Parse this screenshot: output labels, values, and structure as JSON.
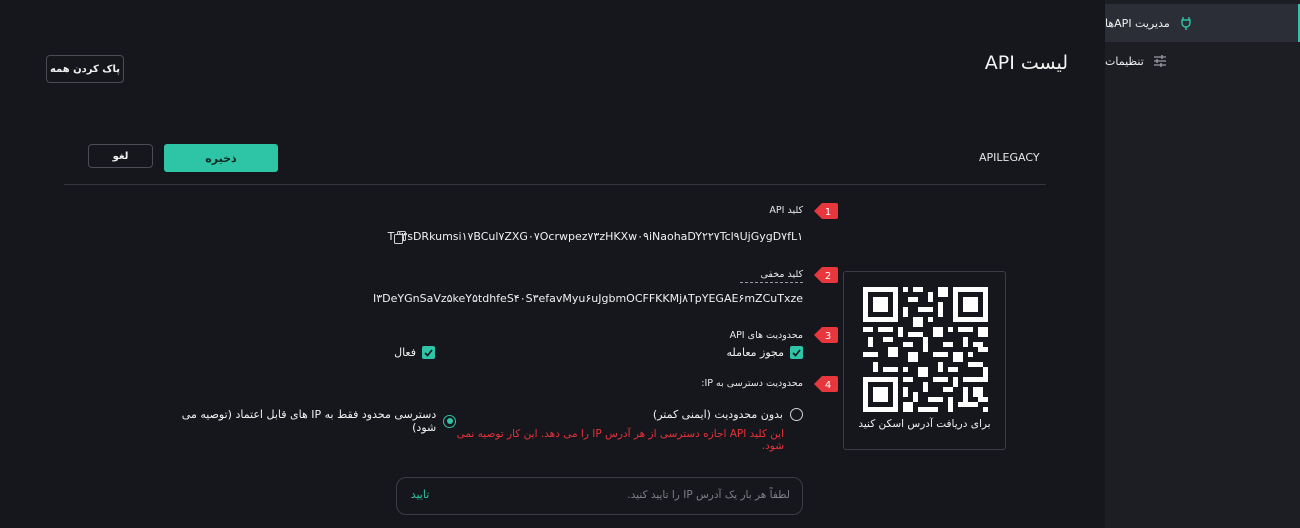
{
  "sidebar": {
    "items": [
      {
        "label": "مدیریت APIها",
        "icon": "plug-icon"
      },
      {
        "label": "تنظیمات",
        "icon": "sliders-icon"
      }
    ]
  },
  "header": {
    "title": "لیست API",
    "clear_all_label": "پاک کردن همه"
  },
  "api_entry": {
    "name": "APILEGACY",
    "save_label": "ذخیره",
    "cancel_label": "لغو"
  },
  "fields": {
    "api_key_label": "کلید API",
    "api_key_value": "Td۳sDRkumsi۱۷BCul۷ZXG۰۷Ocrwpez۷۳zHKXw۰۹iNaohaDY۲۲۷Tcl۹UjGygD۷fL۱",
    "secret_key_label": "کلید مخفی",
    "secret_key_value": "I۳DeYGnSaVz۵keY۵tdhfeS۴۰S۳efavMyu۶uJgbmOCFFKKMj۸TpYEGAE۶mZCuTxze",
    "restrictions_label": "محدودیت های API",
    "trade_permission_label": "مجوز معامله",
    "active_label": "فعال",
    "ip_restriction_label": "محدودیت دسترسی به IP:",
    "no_restriction_label": "بدون محدودیت (ایمنی کمتر)",
    "restricted_label": "دسترسی محدود فقط به IP های قابل اعتماد (توصیه می شود)",
    "warning_text": "این کلید API اجازه دسترسی از هر آدرس IP را می دهد. این کار توصیه نمی شود.",
    "ip_placeholder": "لطفاً هر بار یک آدرس IP را تایید کنید.",
    "confirm_label": "تایید"
  },
  "badges": [
    "1",
    "2",
    "3",
    "4"
  ],
  "qr": {
    "caption": "برای دریافت آدرس اسکن کنید"
  },
  "colors": {
    "accent": "#2ec4a6",
    "badge": "#e8363d",
    "warning": "#e5323a",
    "background": "#15171c"
  }
}
